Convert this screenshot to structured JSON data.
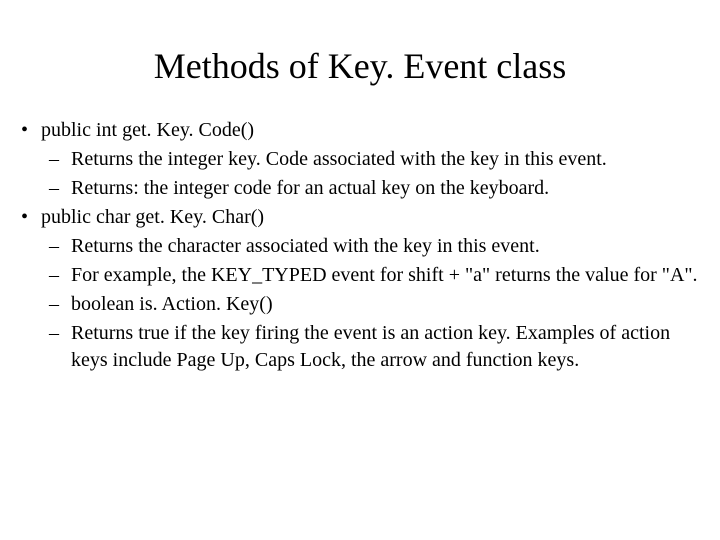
{
  "title": "Methods of Key. Event class",
  "items": [
    {
      "text": "public int get. Key. Code()",
      "sub": [
        "Returns the integer key. Code associated with the key in this event.",
        "Returns: the integer code for an actual key on the keyboard."
      ]
    },
    {
      "text": "public char get. Key. Char()",
      "sub": [
        "Returns the character associated with the key in this event.",
        "For example, the KEY_TYPED event for shift + \"a\" returns the value for \"A\".",
        "boolean is. Action. Key()",
        "Returns true if the key firing the event is an action key. Examples of action keys include Page Up, Caps Lock, the arrow and function keys."
      ]
    }
  ]
}
